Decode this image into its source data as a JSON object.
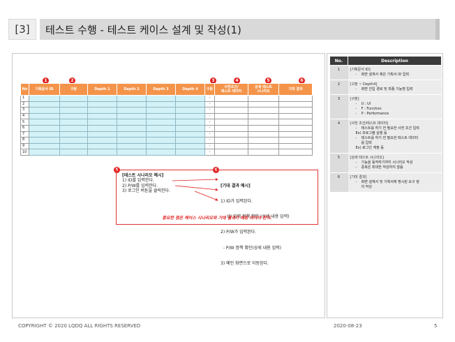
{
  "header": {
    "number": "[3]",
    "title": "테스트 수행 - 테스트 케이스 설계 및 작성(1)"
  },
  "table": {
    "columns": [
      "No",
      "기획문서 ID",
      "구분",
      "Depth 1",
      "Depth 2",
      "Depth 3",
      "Depth 4",
      "구분",
      "사전조건/\n테스트 데이터",
      "상세 테스트\n시나리오",
      "기대 결과"
    ],
    "badges": [
      "1",
      "2",
      "3",
      "4",
      "5",
      "6"
    ],
    "rows": [
      "1",
      "2",
      "3",
      "4",
      "5",
      "6",
      "7",
      "8",
      "9",
      "10"
    ],
    "dash": "-"
  },
  "example": {
    "badge_left": "5",
    "badge_right": "6",
    "scenario_header": "[테스트 시나리오 예시]",
    "scenario_lines": [
      "1) ID를 입력한다.",
      "2) P/W를 입력한다.",
      "3) 로그인 버튼을 클릭한다."
    ],
    "result_header": "[기대 결과 예시]",
    "result_lines": [
      "1) ID가 입력된다.",
      "  -  ID 입력 정책 확인 (상세 내용 입력)",
      "2) P/W가 입력된다.",
      "  - P/W 정책 확인(상세 내용 입력)",
      "3) 메인 화면으로 이동된다."
    ],
    "note": "중요한 점은 케이스 시나리오와 기대 결과가 매칭 되어야 한다."
  },
  "description": {
    "col_no": "No.",
    "col_desc": "Description",
    "items": [
      {
        "no": "1",
        "head": "[기획문서 ID]",
        "lines": [
          "-    화면 설계서 혹은 기획서 ID 입력"
        ]
      },
      {
        "no": "2",
        "head": "[구분 ~ Depth4]",
        "lines": [
          "-    화면 진입 경로 및 최종 기능명 입력"
        ]
      },
      {
        "no": "3",
        "head": "[구분]",
        "lines": [
          "-    U : UI",
          "-    F : Function",
          "-    P : Performance"
        ]
      },
      {
        "no": "4",
        "head": "[사전 조건/테스트 데이터]",
        "lines": [
          "-    테스트를 하기 전 필요한 사전 조건 입력",
          "Ex) 프로그램 실행 등",
          "-    테스트를 하기 전 필요한 테스트 데이터",
          "     를 입력",
          "Ex) 로그인 계정 등"
        ]
      },
      {
        "no": "5",
        "head": "[상세 테스트 시나리오]",
        "lines": [
          "-    기능을 동작하기까지 시나리오 작성",
          "-    중복은 최대한 작성하지 않음"
        ]
      },
      {
        "no": "6",
        "head": "[기대 결과]",
        "lines": [
          "-    화면 설계서 및 기획서에 명시된 요구 정",
          "     의 작성"
        ]
      }
    ]
  },
  "footer": {
    "copyright": "COPYRIGHT © 2020 LQDQ ALL RIGHTS RESERVED",
    "date": "2020-08-23",
    "page": "5"
  }
}
